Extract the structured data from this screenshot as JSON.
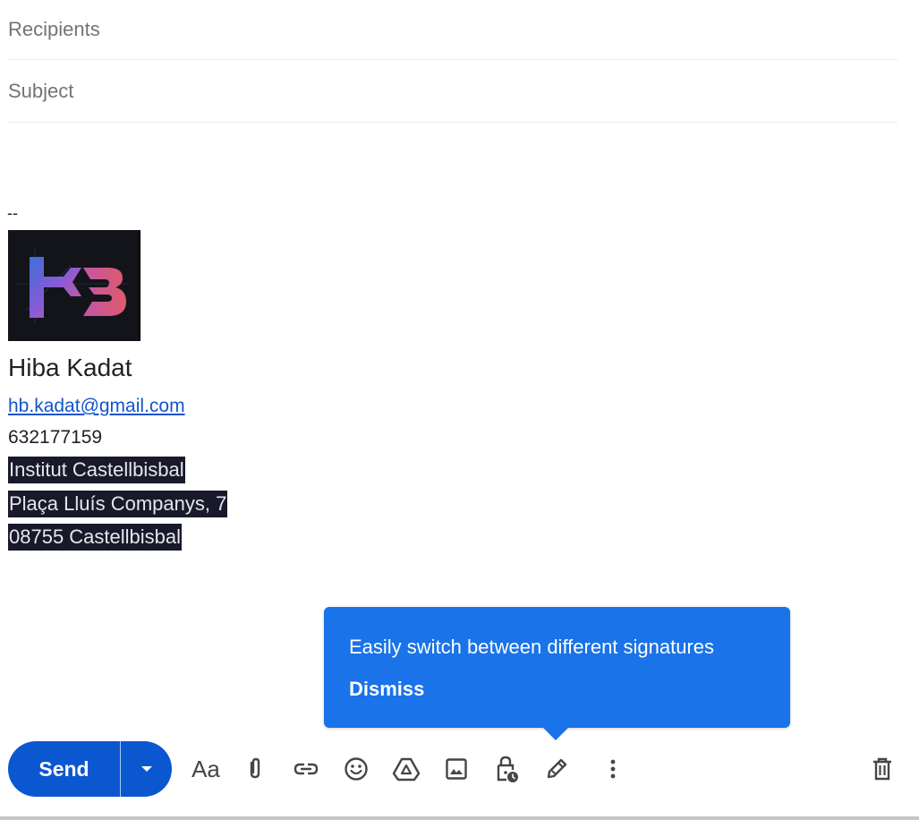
{
  "compose": {
    "recipients_placeholder": "Recipients",
    "subject_placeholder": "Subject"
  },
  "signature": {
    "separator": "--",
    "name": "Hiba Kadat",
    "email": "hb.kadat@gmail.com",
    "phone": "632177159",
    "address_lines": [
      "Institut Castellbisbal",
      "Plaça Lluís Companys, 7",
      "08755 Castellbisbal"
    ],
    "logo_text": "HB"
  },
  "tooltip": {
    "message": "Easily switch between different signatures",
    "dismiss_label": "Dismiss"
  },
  "toolbar": {
    "send_label": "Send",
    "format_label": "Aa",
    "icons": [
      "chevron-down-icon",
      "format-text-icon",
      "attach-icon",
      "link-icon",
      "emoji-icon",
      "drive-icon",
      "image-icon",
      "confidential-lock-icon",
      "signature-pen-icon",
      "more-vert-icon",
      "trash-icon"
    ]
  },
  "colors": {
    "send_blue": "#0b57d0",
    "tooltip_blue": "#1a73e8",
    "icon_gray": "#444746",
    "link_blue": "#1155cc",
    "highlight_bg": "#181a2b"
  }
}
